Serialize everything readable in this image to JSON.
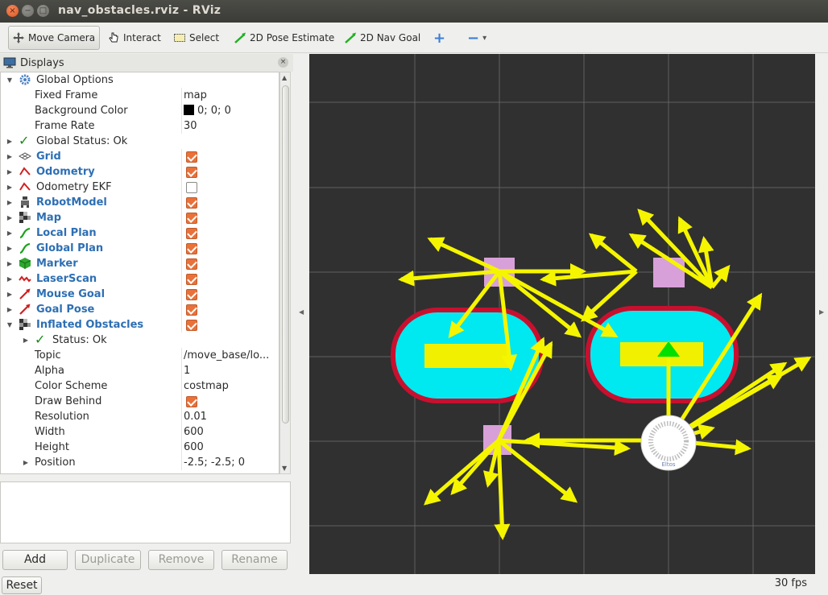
{
  "window": {
    "title": "nav_obstacles.rviz - RViz",
    "close_glyph": "×",
    "min_glyph": "−",
    "max_glyph": "□"
  },
  "toolbar": {
    "move_camera": "Move Camera",
    "interact": "Interact",
    "select": "Select",
    "pose_estimate": "2D Pose Estimate",
    "nav_goal": "2D Nav Goal",
    "add_glyph": "+",
    "remove_glyph": "−",
    "dropdown_glyph": "▾"
  },
  "displays": {
    "header": "Displays",
    "close_glyph": "×",
    "rows": [
      {
        "label": "Global Options",
        "value": ""
      },
      {
        "label": "Fixed Frame",
        "value": "map"
      },
      {
        "label": "Background Color",
        "value": "0; 0; 0"
      },
      {
        "label": "Frame Rate",
        "value": "30"
      },
      {
        "label": "Global Status: Ok",
        "value": ""
      },
      {
        "label": "Grid",
        "checked": true
      },
      {
        "label": "Odometry",
        "checked": true
      },
      {
        "label": "Odometry EKF",
        "checked": false
      },
      {
        "label": "RobotModel",
        "checked": true
      },
      {
        "label": "Map",
        "checked": true
      },
      {
        "label": "Local Plan",
        "checked": true
      },
      {
        "label": "Global Plan",
        "checked": true
      },
      {
        "label": "Marker",
        "checked": true
      },
      {
        "label": "LaserScan",
        "checked": true
      },
      {
        "label": "Mouse Goal",
        "checked": true
      },
      {
        "label": "Goal Pose",
        "checked": true
      },
      {
        "label": "Inflated Obstacles",
        "checked": true
      },
      {
        "label": "Status: Ok",
        "value": ""
      },
      {
        "label": "Topic",
        "value": "/move_base/lo..."
      },
      {
        "label": "Alpha",
        "value": "1"
      },
      {
        "label": "Color Scheme",
        "value": "costmap"
      },
      {
        "label": "Draw Behind",
        "checked": true
      },
      {
        "label": "Resolution",
        "value": "0.01"
      },
      {
        "label": "Width",
        "value": "600"
      },
      {
        "label": "Height",
        "value": "600"
      },
      {
        "label": "Position",
        "value": "-2.5; -2.5; 0"
      }
    ],
    "buttons": {
      "add": "Add",
      "duplicate": "Duplicate",
      "remove": "Remove",
      "rename": "Rename"
    }
  },
  "status": {
    "reset": "Reset",
    "fps": "30 fps"
  },
  "view": {
    "robot_label": "Eltos",
    "colors": {
      "background": "#303030",
      "grid": "#8a8a8a",
      "arrow": "#f5f500",
      "inflation": "#00e8f0",
      "inflation_border": "#c8102e",
      "obstacle": "#f0f000",
      "goal": "#d8a0d8",
      "pose": "#00e000"
    }
  }
}
